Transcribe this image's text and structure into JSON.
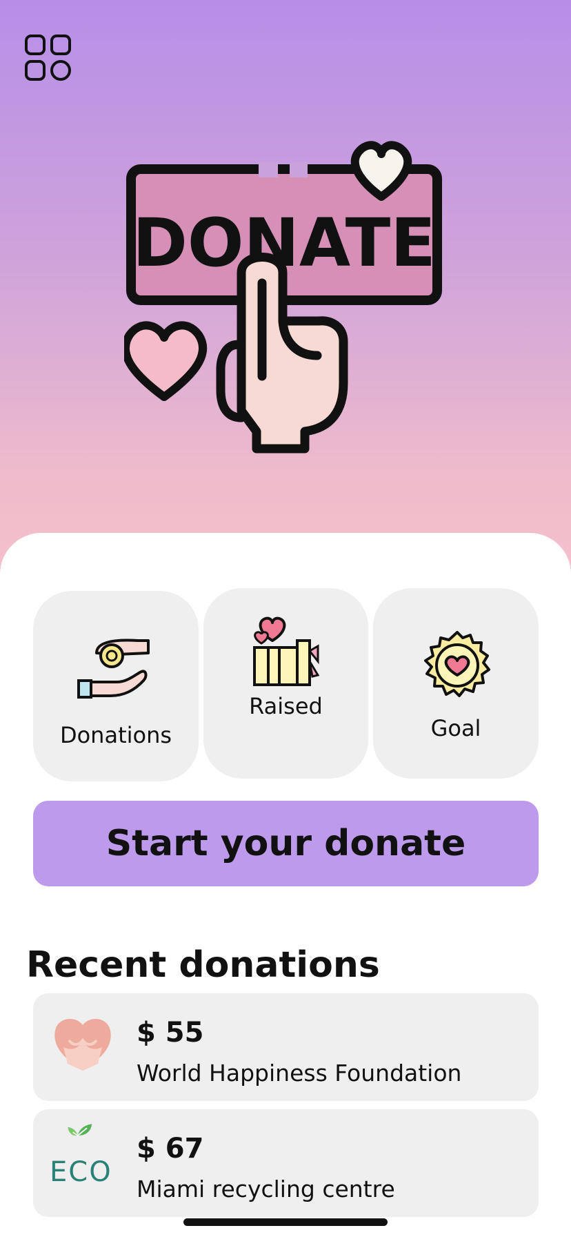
{
  "hero": {
    "banner_text": "DONATE"
  },
  "stats": [
    {
      "label": "Donations",
      "icon": "hand-coin-icon"
    },
    {
      "label": "Raised",
      "icon": "gift-hearts-icon"
    },
    {
      "label": "Goal",
      "icon": "heart-badge-icon"
    }
  ],
  "cta": {
    "label": "Start your donate",
    "color": "#bd9aeb"
  },
  "recent": {
    "title": "Recent donations",
    "items": [
      {
        "amount": "$ 55",
        "organization": "World Happiness Foundation",
        "logo": "hands-heart-logo"
      },
      {
        "amount": "$ 67",
        "organization": "Miami recycling centre",
        "logo": "eco-leaf-logo",
        "logo_text": "ECO"
      }
    ]
  },
  "colors": {
    "hero_top": "#b68ee8",
    "hero_bottom": "#f4c0cc",
    "card_bg": "#efefef"
  }
}
